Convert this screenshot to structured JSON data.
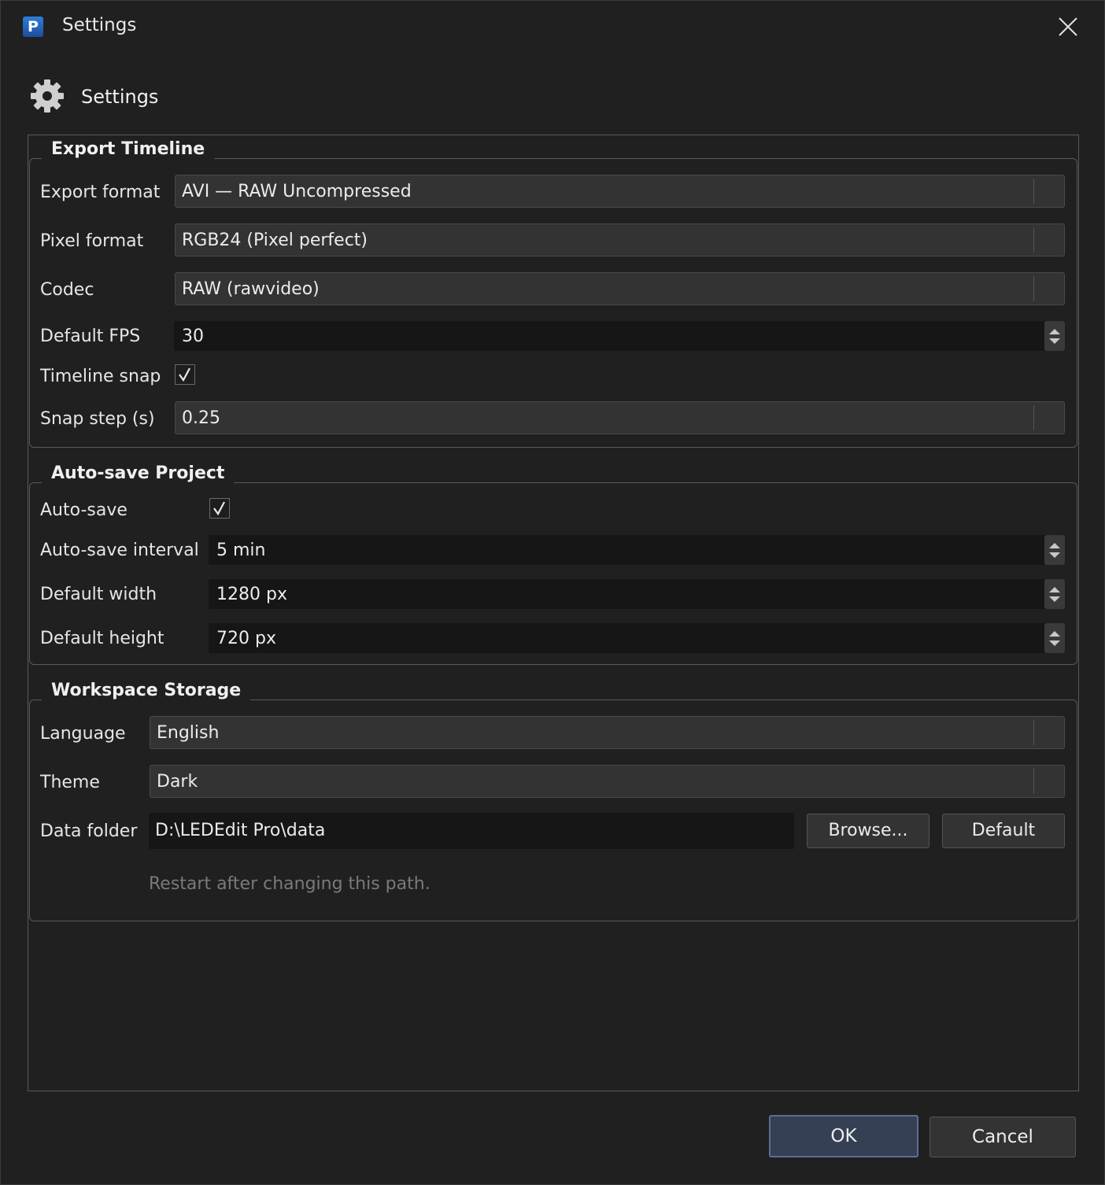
{
  "window": {
    "title": "Settings",
    "app_icon_letter": "P",
    "close_icon": "close-icon"
  },
  "header": {
    "title": "Settings",
    "icon": "gear-icon"
  },
  "export_group": {
    "legend": "Export Timeline",
    "export_format": {
      "label": "Export format",
      "value": "AVI — RAW Uncompressed"
    },
    "pixel_format": {
      "label": "Pixel format",
      "value": "RGB24 (Pixel perfect)"
    },
    "codec": {
      "label": "Codec",
      "value": "RAW (rawvideo)"
    },
    "default_fps": {
      "label": "Default FPS",
      "value": "30"
    },
    "timeline_snap": {
      "label": "Timeline snap",
      "checked": true
    },
    "snap_step": {
      "label": "Snap step (s)",
      "value": "0.25"
    }
  },
  "autosave_group": {
    "legend": "Auto-save Project",
    "auto_save": {
      "label": "Auto-save",
      "checked": true
    },
    "auto_save_interval": {
      "label": "Auto-save interval",
      "value": "5 min"
    },
    "default_width": {
      "label": "Default width",
      "value": "1280 px"
    },
    "default_height": {
      "label": "Default height",
      "value": "720 px"
    }
  },
  "workspace_group": {
    "legend": "Workspace Storage",
    "language": {
      "label": "Language",
      "value": "English"
    },
    "theme": {
      "label": "Theme",
      "value": "Dark"
    },
    "data_folder": {
      "label": "Data folder",
      "value": "D:\\LEDEdit Pro\\data",
      "browse_label": "Browse...",
      "default_label": "Default"
    },
    "hint": "Restart after changing this path."
  },
  "footer": {
    "ok_label": "OK",
    "cancel_label": "Cancel"
  },
  "colors": {
    "background": "#202020",
    "field_dark": "#161616",
    "combo": "#333333",
    "ok_accent": "#354055",
    "ok_border": "#5b6f93",
    "hint_text": "#7a7a7a"
  }
}
